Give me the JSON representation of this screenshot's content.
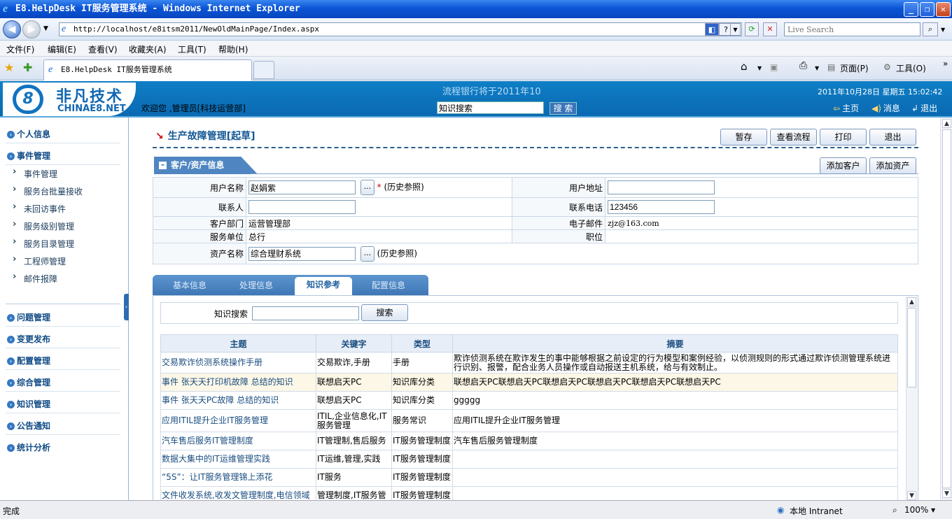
{
  "window": {
    "title": "E8.HelpDesk IT服务管理系统 - Windows Internet Explorer"
  },
  "browser": {
    "url": "http://localhost/e8itsm2011/NewOldMainPage/Index.aspx",
    "search_placeholder": "Live Search",
    "menu": [
      "文件(F)",
      "编辑(E)",
      "查看(V)",
      "收藏夹(A)",
      "工具(T)",
      "帮助(H)"
    ],
    "tab_title": "E8.HelpDesk IT服务管理系统",
    "toolbar": {
      "page": "页面(P)",
      "tools": "工具(O)"
    }
  },
  "header": {
    "logo_cn": "非凡技术",
    "logo_en": "CHINAE8.NET",
    "logo_mark": "8",
    "welcome": "欢迎您 ,管理员[科技运营部]",
    "banner": "流程银行将于2011年10",
    "search_value": "知识搜索",
    "search_button": "搜 索",
    "datetime": "2011年10月28日 星期五 15:02:42",
    "links": {
      "home": "主页",
      "messages": "消息",
      "logout": "退出"
    }
  },
  "sidebar": {
    "sections": [
      "个人信息",
      "事件管理",
      "问题管理",
      "变更发布",
      "配置管理",
      "综合管理",
      "知识管理",
      "公告通知",
      "统计分析"
    ],
    "event_items": [
      "事件管理",
      "服务台批量接收",
      "未回访事件",
      "服务级别管理",
      "服务目录管理",
      "工程师管理",
      "邮件报障"
    ]
  },
  "page": {
    "title": "生产故障管理[起草]",
    "buttons": {
      "save": "暂存",
      "view_flow": "查看流程",
      "print": "打印",
      "exit": "退出"
    },
    "section_title": "客户/资产信息",
    "section_buttons": {
      "add_customer": "添加客户",
      "add_asset": "添加资产"
    },
    "customer": {
      "user_name_label": "用户名称",
      "user_name": "赵娟紫",
      "history": "(历史参照)",
      "user_address_label": "用户地址",
      "user_address": "",
      "contact_label": "联系人",
      "contact": "",
      "phone_label": "联系电话",
      "phone": "123456",
      "dept_label": "客户部门",
      "dept": "运营管理部",
      "email_label": "电子邮件",
      "email": "zjz@163.com",
      "unit_label": "服务单位",
      "unit": "总行",
      "position_label": "职位",
      "position": "",
      "asset_label": "资产名称",
      "asset": "综合理财系统",
      "asset_history": "(历史参照)"
    },
    "tabs": [
      "基本信息",
      "处理信息",
      "知识参考",
      "配置信息"
    ],
    "active_tab": "知识参考",
    "knowledge": {
      "search_label": "知识搜索",
      "search_value": "",
      "search_button": "搜索",
      "headers": [
        "主题",
        "关键字",
        "类型",
        "摘要"
      ],
      "rows": [
        {
          "topic": "交易欺诈侦测系统操作手册",
          "keywords": "交易欺诈,手册",
          "type": "手册",
          "summary": "欺诈侦测系统在欺诈发生的事中能够根据之前设定的行为模型和案例经验，以侦测规则的形式通过欺诈侦测管理系统进行识别、报警，配合业务人员操作或自动报送主机系统，给与有效制止。"
        },
        {
          "topic": "事件 张天天打印机故障 总结的知识",
          "keywords": "联想启天PC",
          "type": "知识库分类",
          "summary": "联想启天PC联想启天PC联想启天PC联想启天PC联想启天PC联想启天PC"
        },
        {
          "topic": "事件 张天天PC故障 总结的知识",
          "keywords": "联想启天PC",
          "type": "知识库分类",
          "summary": "ggggg"
        },
        {
          "topic": "应用ITIL提升企业IT服务管理",
          "keywords": "ITIL,企业信息化,IT服务管理",
          "type": "服务常识",
          "summary": "应用ITIL提升企业IT服务管理"
        },
        {
          "topic": "汽车售后服务IT管理制度",
          "keywords": "IT管理制,售后服务",
          "type": "IT服务管理制度",
          "summary": "汽车售后服务管理制度"
        },
        {
          "topic": "数据大集中的IT运维管理实践",
          "keywords": "IT运维,管理,实践",
          "type": "IT服务管理制度",
          "summary": ""
        },
        {
          "topic": "“5S”：让IT服务管理锦上添花",
          "keywords": "IT服务",
          "type": "IT服务管理制度",
          "summary": ""
        },
        {
          "topic": "文件收发系统,收发文管理制度,电信领域",
          "keywords": "管理制度,IT服务管",
          "type": "IT服务管理制度",
          "summary": ""
        }
      ]
    }
  },
  "statusbar": {
    "status": "完成",
    "zone": "本地 Intranet",
    "zoom": "100%"
  }
}
